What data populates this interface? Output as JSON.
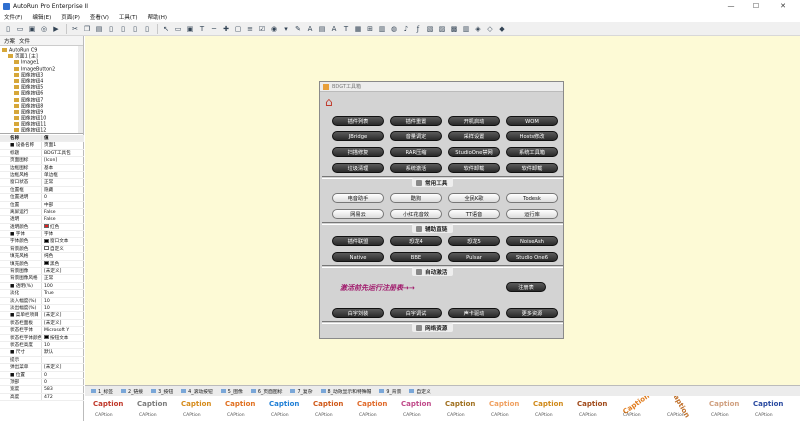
{
  "app": {
    "title": "AutoRun Pro Enterprise II"
  },
  "window_controls": {
    "minimize": "—",
    "maximize": "☐",
    "close": "✕"
  },
  "menu": [
    "文件(F)",
    "编辑(E)",
    "页面(P)",
    "查看(V)",
    "工具(T)",
    "帮助(H)"
  ],
  "toolbar_icons": [
    "new-icon",
    "open-icon",
    "save-icon",
    "preview-icon",
    "run-icon",
    "sep",
    "cut-icon",
    "copy-icon",
    "paste-icon",
    "page-icon",
    "page2-icon",
    "page3-icon",
    "page4-icon",
    "sep",
    "pointer-icon",
    "button-icon",
    "image-icon",
    "text-icon",
    "line-icon",
    "cross-icon",
    "frame-icon",
    "list-icon",
    "checkbox-icon",
    "radio-icon",
    "combo-icon",
    "edit-icon",
    "label-icon",
    "tab-icon",
    "text-a-icon",
    "text-b-icon",
    "grid-icon",
    "tree-icon",
    "panel-icon",
    "browser-icon",
    "media-icon",
    "flash-icon",
    "pdf-icon",
    "doc-icon",
    "chart-icon",
    "chart2-icon",
    "misc-icon",
    "misc2-icon",
    "misc3-icon"
  ],
  "left_panel": {
    "tabs": [
      "方案",
      "文件"
    ],
    "tree": [
      "AutoRun C9",
      "页面1 [主]",
      "Image1",
      "ImageButton2",
      "图像按钮3",
      "图像按钮4",
      "图像按钮5",
      "图像按钮6",
      "图像按钮7",
      "图像按钮8",
      "图像按钮9",
      "图像按钮10",
      "图像按钮11",
      "图像按钮12",
      "图像按钮13",
      "图像按钮14"
    ],
    "props_header": {
      "name": "名称",
      "value": "值"
    },
    "props": [
      {
        "k": "■ 设备名称",
        "v": "页面1"
      },
      {
        "k": "标题",
        "v": "BDGT工具包"
      },
      {
        "k": "页面图标",
        "v": "[Icon]"
      },
      {
        "k": "边框图标",
        "v": "基本"
      },
      {
        "k": "边框风格",
        "v": "单边框"
      },
      {
        "k": "窗口状态",
        "v": "正常"
      },
      {
        "k": "位置框",
        "v": "隐藏"
      },
      {
        "k": "位置透明",
        "v": "0"
      },
      {
        "k": "位置",
        "v": "中部"
      },
      {
        "k": "离屏运行",
        "v": "False"
      },
      {
        "k": "透明",
        "v": "False"
      },
      {
        "k": "透明颜色",
        "v": "红色",
        "swatch": "#e02020"
      },
      {
        "k": "■ 字体",
        "v": "字体"
      },
      {
        "k": "字体颜色",
        "v": "窗口文本",
        "swatch": "#000000"
      },
      {
        "k": "背景颜色",
        "v": "自定义",
        "swatch": "#ffffff"
      },
      {
        "k": "填充风格",
        "v": "纯色"
      },
      {
        "k": "填充颜色",
        "v": "黑色",
        "swatch": "#000000"
      },
      {
        "k": "背景图像",
        "v": "[未定义]"
      },
      {
        "k": "背景图像风格",
        "v": "正常"
      },
      {
        "k": "■ 透明(%)",
        "v": "100"
      },
      {
        "k": "淡化",
        "v": "True"
      },
      {
        "k": "淡入幅度(%)",
        "v": "10"
      },
      {
        "k": "淡出幅度(%)",
        "v": "10"
      },
      {
        "k": "■ 菜单栏项目",
        "v": "[未定义]"
      },
      {
        "k": "状态栏面板",
        "v": "[未定义]"
      },
      {
        "k": "状态栏字体",
        "v": "Microsoft Y"
      },
      {
        "k": "状态栏字体颜色",
        "v": "按钮文本",
        "swatch": "#000000"
      },
      {
        "k": "状态栏高度",
        "v": "10"
      },
      {
        "k": "■ 尺寸",
        "v": "默认"
      },
      {
        "k": "提示",
        "v": ""
      },
      {
        "k": "弹出菜单",
        "v": "[未定义]"
      },
      {
        "k": "■ 位置",
        "v": "0"
      },
      {
        "k": "顶部",
        "v": "0"
      },
      {
        "k": "宽度",
        "v": "583"
      },
      {
        "k": "高度",
        "v": "472"
      }
    ]
  },
  "dialog": {
    "title": "BDGT工具箱",
    "rows": [
      [
        "插件列表",
        "插件重置",
        "开机启动",
        "WOM"
      ],
      [
        "JBridge",
        "音量调定",
        "采样设置",
        "Hosts修改"
      ],
      [
        "扫描修复",
        "RAR压缩",
        "StudioOne禁网",
        "系统工具箱"
      ],
      [
        "垃圾清理",
        "系统激活",
        "软件卸载",
        "软件卸载"
      ],
      [
        "电音助手",
        "酷狗",
        "全民K歌",
        "Todesk"
      ],
      [
        "网易云",
        "小红花音效",
        "TT语音",
        "运行库"
      ],
      [
        "插件联盟",
        "恐龙4",
        "恐龙5",
        "NoiseAsh"
      ],
      [
        "Native",
        "BBE",
        "Pulsar",
        "Studio One6"
      ],
      [
        "白宇刘装",
        "白宇调试",
        "声卡驱动",
        "更多资源"
      ]
    ],
    "sections": [
      "常用工具",
      "辅助直链",
      "自动激活",
      "网络资源"
    ],
    "activate_text": "激活前先运行注册表→→",
    "register_button": "注册表"
  },
  "bottom_tabs": [
    "1_标签",
    "2_链接",
    "3_按钮",
    "4_滚动按钮",
    "5_图像",
    "6_页面图标",
    "7_复杂",
    "8_动效显示和特殊帽",
    "9_背景",
    "自定义"
  ],
  "gallery": {
    "caption": "Caption",
    "styles": [
      {
        "color": "#c0392b"
      },
      {
        "color": "#7b7b7b"
      },
      {
        "color": "#d68b1b"
      },
      {
        "color": "#e07020"
      },
      {
        "color": "#1f7fd6"
      },
      {
        "color": "#d05a1a"
      },
      {
        "color": "#e06a2a"
      },
      {
        "color": "#c04a8a"
      },
      {
        "color": "#a07020"
      },
      {
        "color": "#f0a060"
      },
      {
        "color": "#d08a1a"
      },
      {
        "color": "#a04a1a"
      },
      {
        "color": "#e07a1a"
      },
      {
        "color": "#c0702a"
      },
      {
        "color": "#d0a080"
      },
      {
        "color": "#2a4aa0"
      }
    ],
    "sub": "CAPtion"
  }
}
